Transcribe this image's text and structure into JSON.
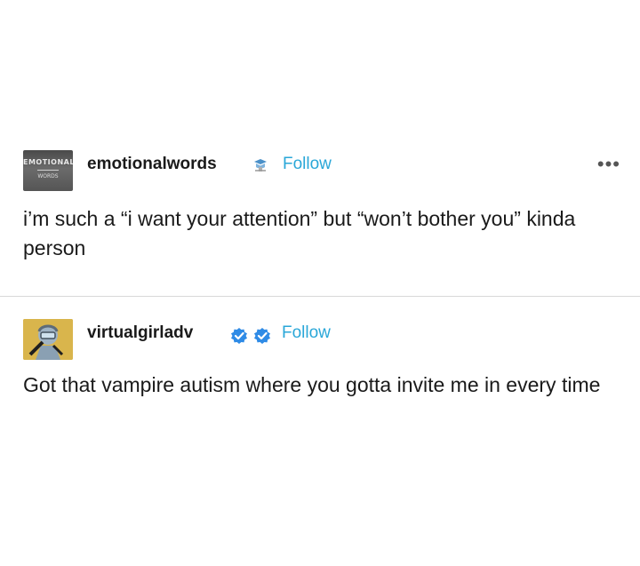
{
  "posts": [
    {
      "avatar_text_top": "EMOTIONAL",
      "avatar_text_bottom": "WORDS",
      "username": "emotionalwords",
      "follow_label": "Follow",
      "more_label": "•••",
      "text": "i’m such a “i want your attention” but “won’t bother you” kinda person"
    },
    {
      "username": "virtualgirladv",
      "follow_label": "Follow",
      "text": "Got that vampire autism where you gotta invite me in every time"
    }
  ],
  "colors": {
    "follow": "#2aa7d8",
    "verified_badge": "#2f8be6",
    "divider": "#d8d8d8"
  },
  "icons": {
    "post1_badge": "blogger-badge-icon",
    "post2_badges": [
      "verified-badge-icon",
      "verified-badge-icon"
    ]
  }
}
